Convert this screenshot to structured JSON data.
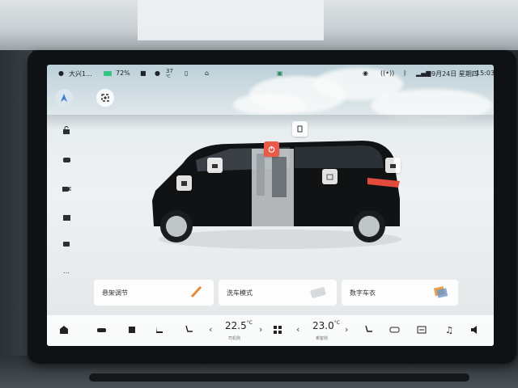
{
  "status": {
    "location": "大兴1...",
    "battery": "72%",
    "temp_value": "37",
    "temp_unit": "℃",
    "date": "9月24日 星期四",
    "time": "15:03"
  },
  "cards": [
    {
      "label": "悬架调节",
      "icon": "suspension-brush-icon"
    },
    {
      "label": "洗车模式",
      "icon": "car-wash-icon"
    },
    {
      "label": "数字车衣",
      "icon": "digital-wrap-icon"
    }
  ],
  "climate": {
    "left_temp": "22.5",
    "left_unit": "°C",
    "left_label": "司机侧",
    "right_temp": "23.0",
    "right_unit": "°C",
    "right_label": "乘客侧"
  },
  "colors": {
    "accent_red": "#ea5a4a",
    "battery_green": "#33c481"
  }
}
